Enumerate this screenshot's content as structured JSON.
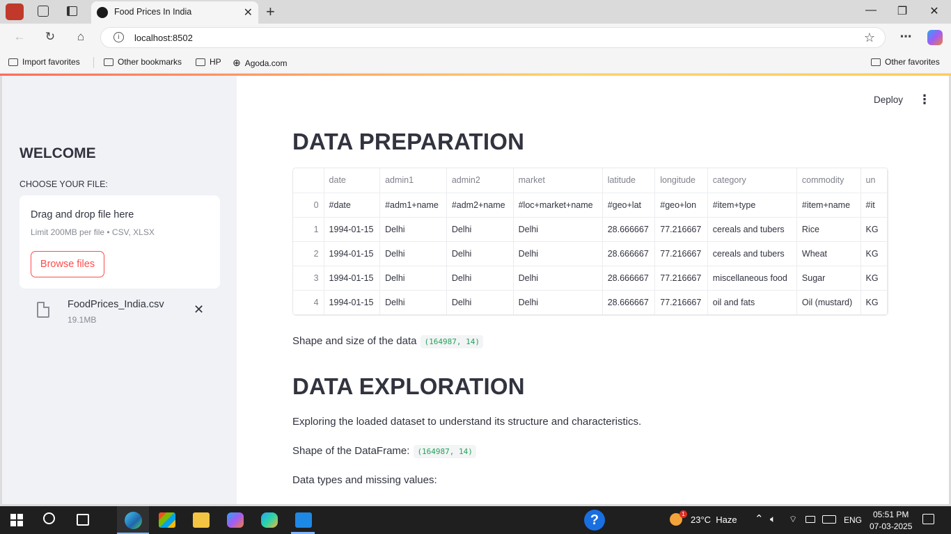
{
  "browser": {
    "tab_title": "Food Prices In India",
    "url": "localhost:8502",
    "bookmarks": [
      "Import favorites",
      "Other bookmarks",
      "HP",
      "Agoda.com"
    ],
    "other_favorites": "Other favorites"
  },
  "sidebar": {
    "welcome": "WELCOME",
    "choose_label": "CHOOSE YOUR FILE:",
    "drop_title": "Drag and drop file here",
    "drop_limit": "Limit 200MB per file • CSV, XLSX",
    "browse_label": "Browse files",
    "file_name": "FoodPrices_India.csv",
    "file_size": "19.1MB"
  },
  "header": {
    "deploy": "Deploy"
  },
  "main": {
    "prep_title": "DATA PREPARATION",
    "shape_text": "Shape and size of the data",
    "shape_value": "(164987, 14)",
    "explore_title": "DATA EXPLORATION",
    "explore_desc": "Exploring the loaded dataset to understand its structure and characteristics.",
    "df_shape_text": "Shape of the DataFrame:",
    "df_shape_value": "(164987, 14)",
    "dtypes_text": "Data types and missing values:"
  },
  "table": {
    "columns": [
      "",
      "date",
      "admin1",
      "admin2",
      "market",
      "latitude",
      "longitude",
      "category",
      "commodity",
      "un"
    ],
    "rows": [
      [
        "0",
        "#date",
        "#adm1+name",
        "#adm2+name",
        "#loc+market+name",
        "#geo+lat",
        "#geo+lon",
        "#item+type",
        "#item+name",
        "#it"
      ],
      [
        "1",
        "1994-01-15",
        "Delhi",
        "Delhi",
        "Delhi",
        "28.666667",
        "77.216667",
        "cereals and tubers",
        "Rice",
        "KG"
      ],
      [
        "2",
        "1994-01-15",
        "Delhi",
        "Delhi",
        "Delhi",
        "28.666667",
        "77.216667",
        "cereals and tubers",
        "Wheat",
        "KG"
      ],
      [
        "3",
        "1994-01-15",
        "Delhi",
        "Delhi",
        "Delhi",
        "28.666667",
        "77.216667",
        "miscellaneous food",
        "Sugar",
        "KG"
      ],
      [
        "4",
        "1994-01-15",
        "Delhi",
        "Delhi",
        "Delhi",
        "28.666667",
        "77.216667",
        "oil and fats",
        "Oil (mustard)",
        "KG"
      ]
    ]
  },
  "taskbar": {
    "weather": "23°C  Haze",
    "weather_badge": "1",
    "lang": "ENG",
    "time": "05:51 PM",
    "date": "07-03-2025"
  }
}
